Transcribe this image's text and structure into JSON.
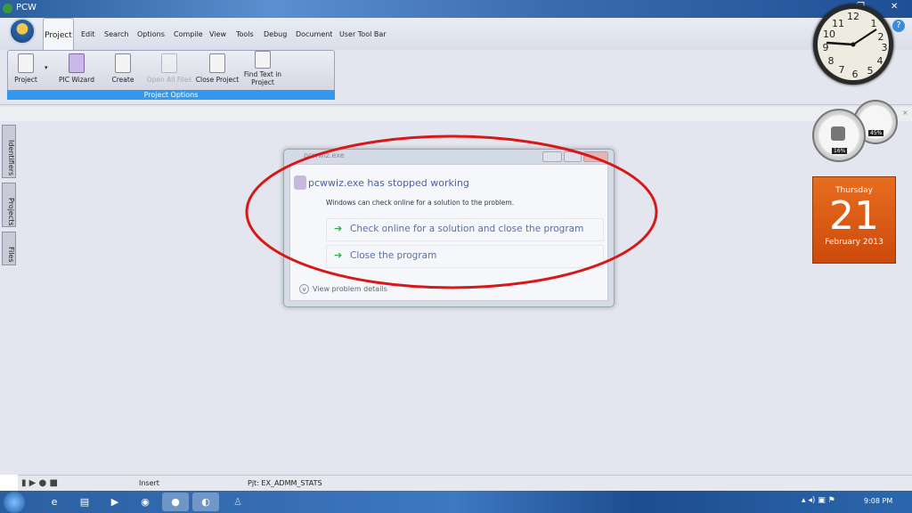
{
  "window": {
    "title": "PCW"
  },
  "menu": {
    "tabs": [
      "Project",
      "Edit",
      "Search",
      "Options",
      "Compile",
      "View",
      "Tools",
      "Debug",
      "Document",
      "User Tool Bar"
    ]
  },
  "ribbon": {
    "group_label": "Project Options",
    "buttons": [
      "Project",
      "PIC Wizard",
      "Create",
      "Open All Files",
      "Close Project",
      "Find Text in Project"
    ]
  },
  "side_tabs": [
    "Identifiers",
    "Projects",
    "Files"
  ],
  "dialog": {
    "window_title": "pcwwiz.exe",
    "heading": "pcwwiz.exe has stopped working",
    "message": "Windows can check online for a solution to the problem.",
    "options": [
      "Check online for a solution and close the program",
      "Close the program"
    ],
    "details": "View problem details"
  },
  "status": {
    "mode": "Insert",
    "project": "Pjt: EX_ADMM_STATS"
  },
  "gadgets": {
    "cpu": "16%",
    "memory": "45%",
    "calendar": {
      "weekday": "Thursday",
      "day": "21",
      "month_year": "February 2013"
    }
  },
  "taskbar": {
    "time": "9:08 PM"
  },
  "colors": {
    "annotation": "#d81818",
    "accent": "#3399ee"
  }
}
